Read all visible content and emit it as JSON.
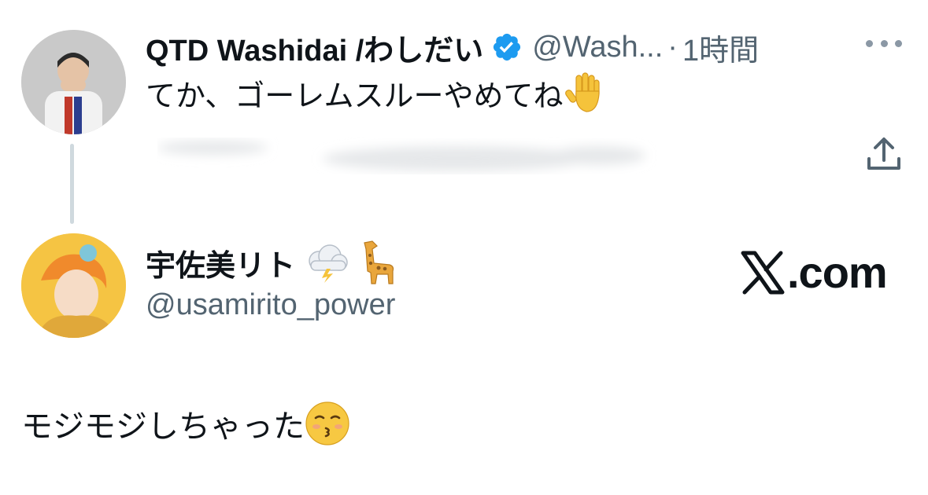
{
  "parent_tweet": {
    "display_name": "QTD Washidai /わしだい",
    "handle": "@Wash...",
    "separator": "·",
    "time": "1時間",
    "text": "てか、ゴーレムスルーやめてね",
    "text_emoji": "raised-hand-emoji",
    "icons": [
      "verified-badge-icon",
      "more-icon",
      "share-icon"
    ]
  },
  "reply_tweet": {
    "display_name": "宇佐美リト",
    "name_emojis": [
      "cloud-lightning-emoji",
      "giraffe-emoji"
    ],
    "handle": "@usamirito_power",
    "text": "モジモジしちゃった",
    "text_emoji": "kissing-face-emoji"
  },
  "brand": {
    "suffix": ".com",
    "logo_icon": "x-logo-icon"
  },
  "colors": {
    "text": "#0f1419",
    "secondary": "#536471",
    "verified": "#1d9bf0",
    "thread_line": "#cfd9de"
  }
}
